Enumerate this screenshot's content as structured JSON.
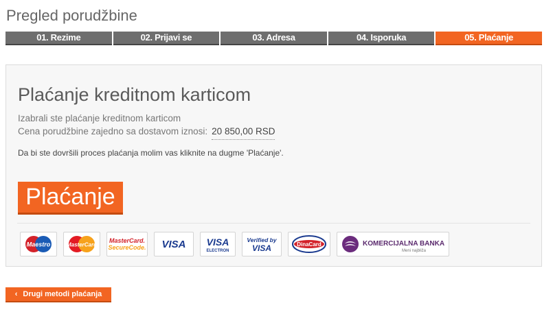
{
  "page": {
    "title": "Pregled porudžbine"
  },
  "steps": [
    {
      "label": "01. Rezime",
      "active": false
    },
    {
      "label": "02. Prijavi se",
      "active": false
    },
    {
      "label": "03. Adresa",
      "active": false
    },
    {
      "label": "04. Isporuka",
      "active": false
    },
    {
      "label": "05. Plaćanje",
      "active": true
    }
  ],
  "payment": {
    "title": "Plaćanje kreditnom karticom",
    "selected_text": "Izabrali ste plaćanje kreditnom karticom",
    "amount_label": "Cena porudžbine zajedno sa dostavom iznosi:",
    "amount": "20 850,00 RSD",
    "instruction": "Da bi ste dovršili proces plaćanja molim vas kliknite na dugme 'Plaćanje'.",
    "pay_button": "Plaćanje"
  },
  "logos": [
    {
      "name": "maestro",
      "text": "Maestro"
    },
    {
      "name": "mastercard",
      "text": "MasterCard"
    },
    {
      "name": "mastercard-securecode",
      "text1": "MasterCard.",
      "text2": "SecureCode."
    },
    {
      "name": "visa",
      "text": "VISA"
    },
    {
      "name": "visa-electron",
      "text1": "VISA",
      "text2": "ELECTRON"
    },
    {
      "name": "verified-by-visa",
      "text1": "Verified by",
      "text2": "VISA"
    },
    {
      "name": "dinacard",
      "text": "DinaCard"
    },
    {
      "name": "komercijalna-banka",
      "text1": "KOMERCIJALNA BANKA",
      "text2": "Meni najbliža"
    }
  ],
  "colors": {
    "accent": "#f26522",
    "step_inactive": "#6e6e6e"
  },
  "back_button": {
    "label": "Drugi metodi plaćanja",
    "icon": "chevron-left-icon"
  }
}
